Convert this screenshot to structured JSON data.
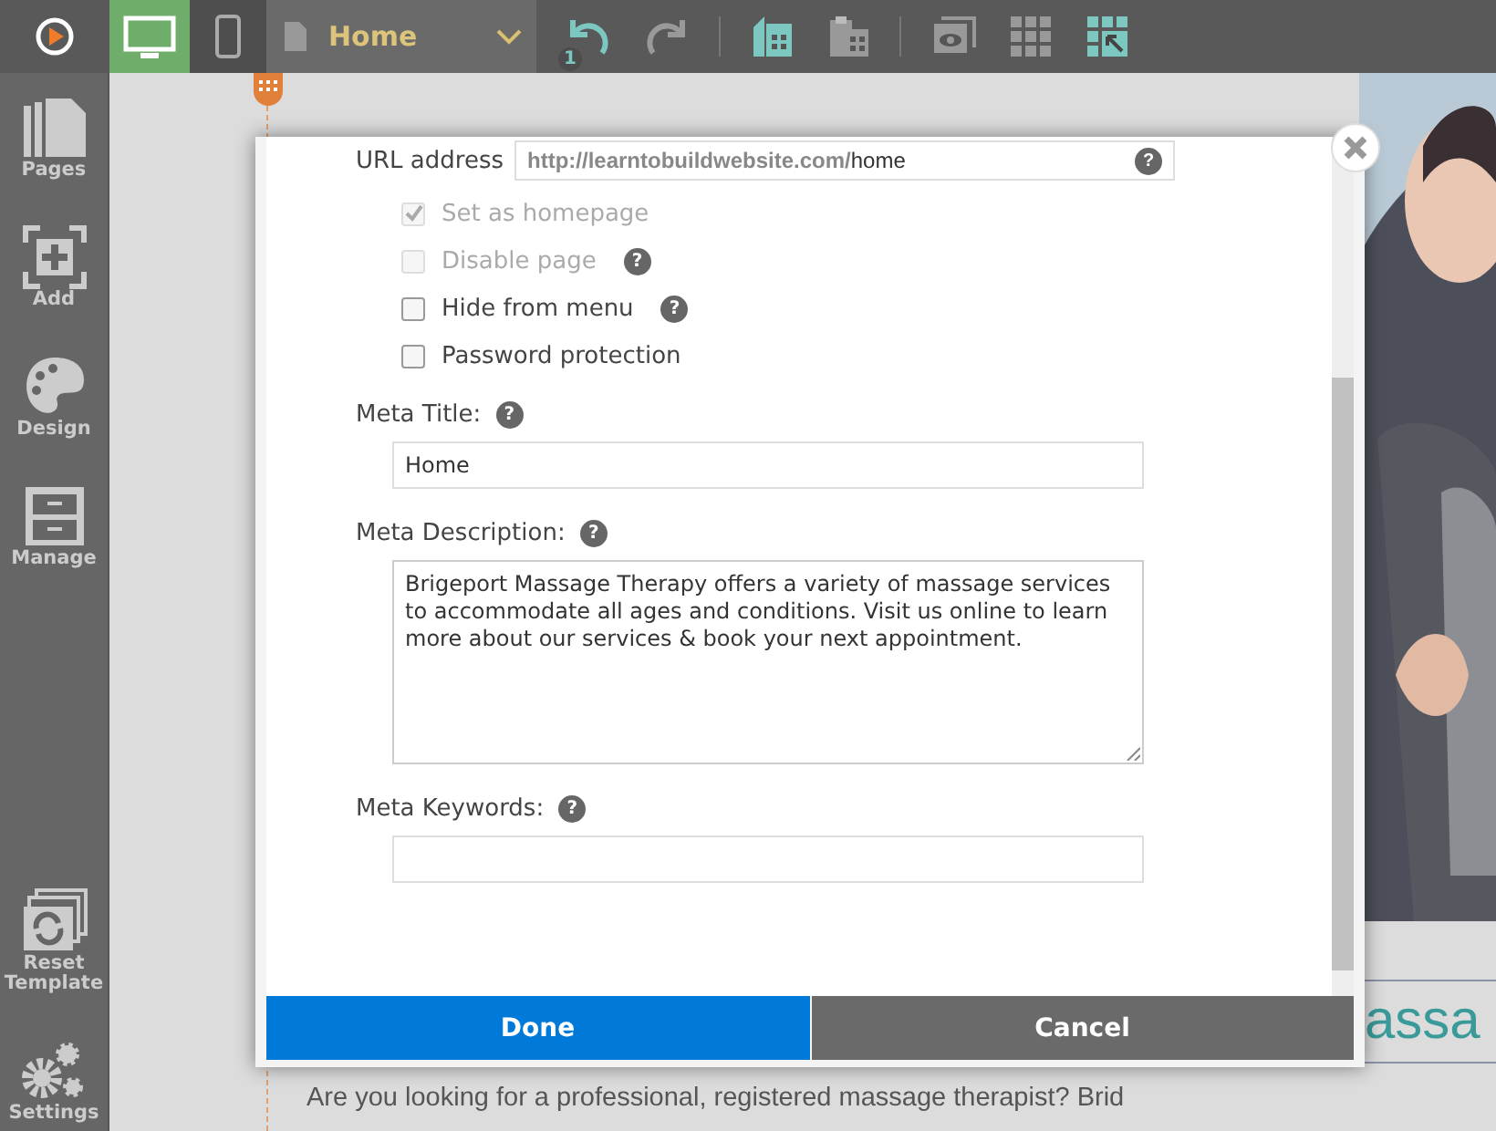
{
  "toolbar": {
    "view_modes": [
      {
        "kind": "desktop",
        "selected": true
      },
      {
        "kind": "mobile",
        "selected": false
      }
    ],
    "page_select": {
      "value": "Home"
    },
    "undo_count": "1",
    "tools": [
      {
        "kind": "duplicate"
      },
      {
        "kind": "paste"
      },
      {
        "kind": "preview"
      },
      {
        "kind": "grid"
      },
      {
        "kind": "exit"
      }
    ]
  },
  "sidebar": {
    "items": [
      {
        "kind": "pages",
        "label": "Pages"
      },
      {
        "kind": "add",
        "label": "Add"
      },
      {
        "kind": "design",
        "label": "Design"
      },
      {
        "kind": "manage",
        "label": "Manage"
      },
      {
        "kind": "reset",
        "label": "Reset Template"
      },
      {
        "kind": "settings",
        "label": "Settings"
      }
    ]
  },
  "site": {
    "heading": "assa",
    "text": "Are you looking for a professional, registered massage therapist? Brid"
  },
  "dialog": {
    "url": {
      "label": "URL address",
      "prefix": "http://learntobuildwebsite.com/",
      "value": "home",
      "help": "?"
    },
    "options": [
      {
        "label": "Set as homepage",
        "checked": true,
        "disabled": true
      },
      {
        "label": "Disable page",
        "checked": false,
        "disabled": true,
        "help": "?"
      },
      {
        "label": "Hide from menu",
        "checked": false,
        "disabled": false,
        "help": "?"
      },
      {
        "label": "Password protection",
        "checked": false,
        "disabled": false
      }
    ],
    "fields": [
      {
        "kind": "input",
        "label": "Meta Title:",
        "help": "?",
        "value": "Home"
      },
      {
        "kind": "textarea",
        "label": "Meta Description:",
        "help": "?",
        "value": "Brigeport Massage Therapy offers a variety of massage services to accommodate all ages and conditions. Visit us online to learn more about our services & book your next appointment."
      },
      {
        "kind": "input",
        "label": "Meta Keywords:",
        "help": "?"
      }
    ],
    "buttons": [
      {
        "kind": "primary",
        "label": "Done"
      },
      {
        "kind": "secondary",
        "label": "Cancel"
      }
    ]
  }
}
